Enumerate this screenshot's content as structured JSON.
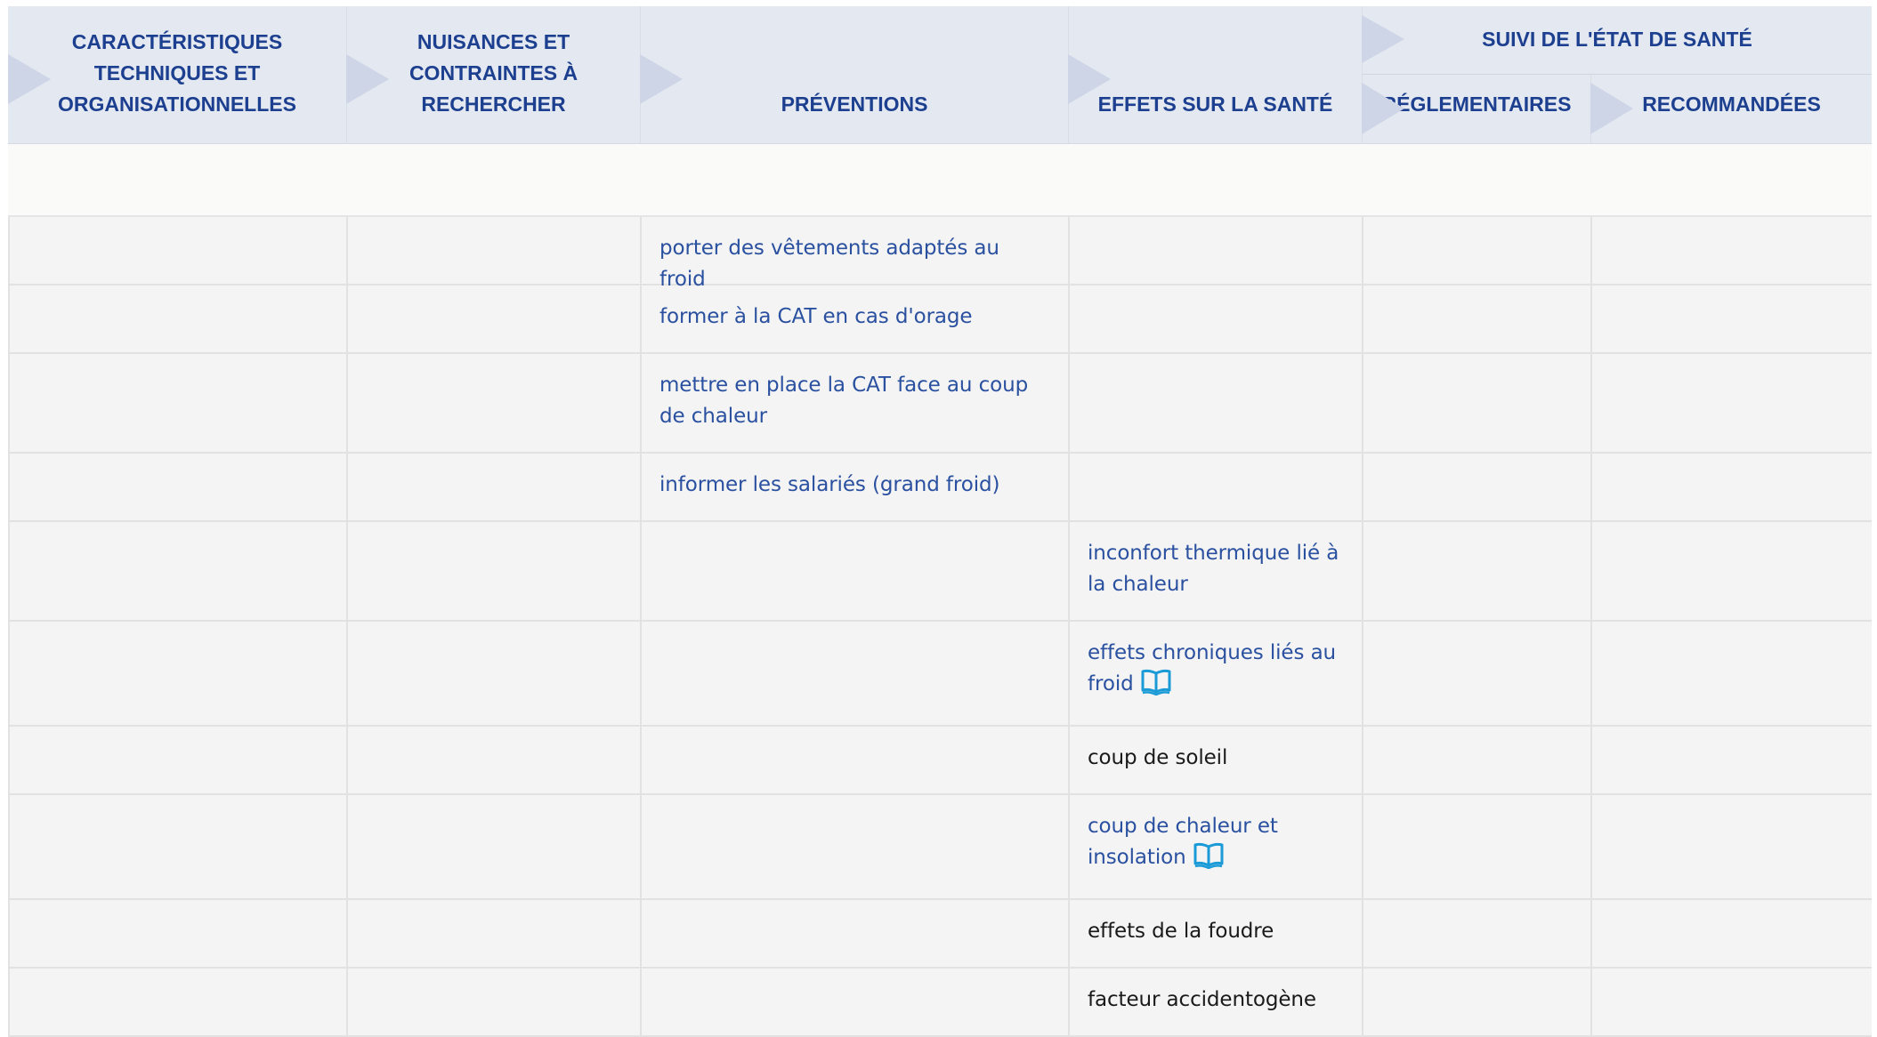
{
  "header": {
    "col1_lines": [
      "CARACTÉRISTIQUES",
      "TECHNIQUES ET",
      "ORGANISATIONNELLES"
    ],
    "col2_lines": [
      "NUISANCES ET",
      "CONTRAINTES À",
      "RECHERCHER"
    ],
    "col3": "PRÉVENTIONS",
    "col4": "EFFETS SUR LA SANTÉ",
    "group": "SUIVI DE L'ÉTAT DE SANTÉ",
    "col5": "RÉGLEMENTAIRES",
    "col6": "RECOMMANDÉES"
  },
  "rows": [
    {
      "prevention": "porter des vêtements adaptés au froid",
      "effet": ""
    },
    {
      "prevention": "former à la CAT en cas d'orage",
      "effet": ""
    },
    {
      "prevention": "mettre en place la CAT face au coup de chaleur",
      "effet": ""
    },
    {
      "prevention": "informer les salariés (grand froid)",
      "effet": ""
    },
    {
      "prevention": "",
      "effet": "inconfort thermique lié à la chaleur"
    },
    {
      "prevention": "",
      "effet": "effets chroniques liés au froid",
      "effet_icon": "book-icon"
    },
    {
      "prevention": "",
      "effet": "coup de soleil"
    },
    {
      "prevention": "",
      "effet": "coup de chaleur et insolation",
      "effet_icon": "book-icon"
    },
    {
      "prevention": "",
      "effet": "effets de la foudre"
    },
    {
      "prevention": "",
      "effet": "facteur accidentogène"
    }
  ],
  "colors": {
    "header_bg": "#e3e8f1",
    "header_text": "#1d3f8f",
    "link_text": "#2a50a0",
    "icon": "#1a9ad6",
    "row_bg": "#f4f4f4"
  }
}
